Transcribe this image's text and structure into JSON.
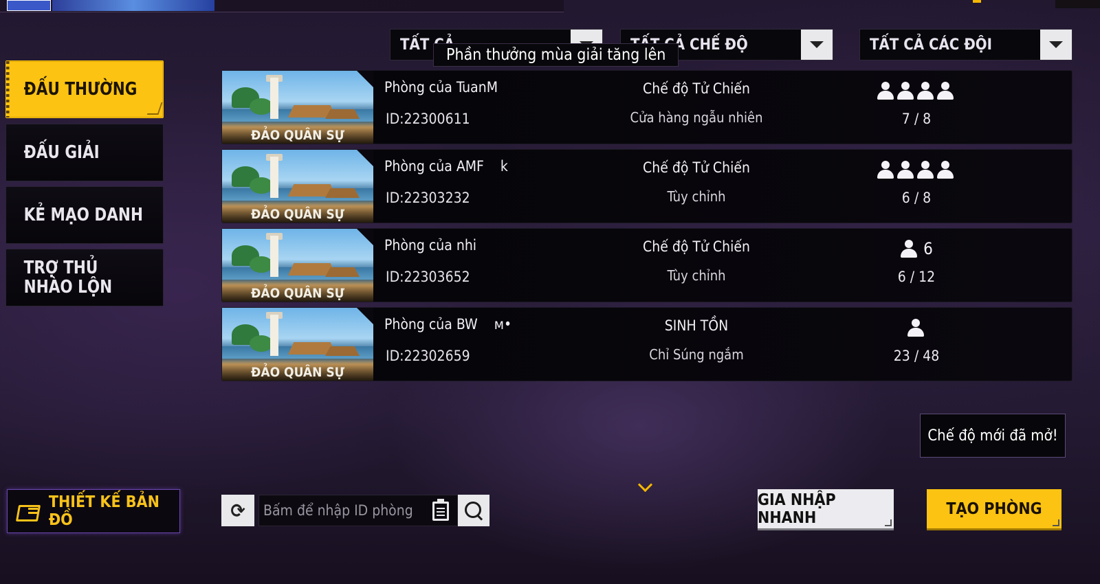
{
  "sidebar": {
    "items": [
      {
        "label": "ĐẤU THƯỜNG",
        "active": true
      },
      {
        "label": "ĐẤU GIẢI",
        "active": false
      },
      {
        "label": "KẺ MẠO DANH",
        "active": false
      },
      {
        "label": "TRỢ THỦ NHÀO LỘN",
        "active": false
      }
    ],
    "map_design_label": "THIẾT KẾ BẢN ĐỒ"
  },
  "filters": {
    "map": "TẤT CẢ",
    "mode": "TẤT CẢ CHẾ ĐỘ",
    "team": "TẤT CẢ CÁC ĐỘI",
    "tooltip": "Phần thưởng mùa giải tăng lên"
  },
  "rooms": [
    {
      "map": "ĐẢO QUÂN SỰ",
      "name": "Phòng của TuanM",
      "id": "ID:22300611",
      "mode": "Chế độ Tử Chiến",
      "sub": "Cửa hàng ngẫu nhiên",
      "team_icon_count": 4,
      "team_label": "",
      "players": "7 / 8"
    },
    {
      "map": "ĐẢO QUÂN SỰ",
      "name": "Phòng của AMF    k",
      "id": "ID:22303232",
      "mode": "Chế độ Tử Chiến",
      "sub": "Tùy chỉnh",
      "team_icon_count": 4,
      "team_label": "",
      "players": "6 / 8"
    },
    {
      "map": "ĐẢO QUÂN SỰ",
      "name": "Phòng của nhi",
      "id": "ID:22303652",
      "mode": "Chế độ Tử Chiến",
      "sub": "Tùy chỉnh",
      "team_icon_count": 1,
      "team_label": "6",
      "players": "6 / 12"
    },
    {
      "map": "ĐẢO QUÂN SỰ",
      "name": "Phòng của BW    ᴍ•",
      "id": "ID:22302659",
      "mode": "SINH TỒN",
      "sub": "Chỉ Súng ngắm",
      "team_icon_count": 1,
      "team_label": "",
      "players": "23 / 48"
    }
  ],
  "notice": "Chế độ mới đã mở!",
  "search": {
    "placeholder": "Bấm để nhập ID phòng"
  },
  "buttons": {
    "quick_join": "GIA NHẬP NHANH",
    "create_room": "TẠO PHÒNG"
  },
  "colors": {
    "accent": "#fcc313",
    "panel": "#07060a",
    "purple_glow": "#6a46b0"
  }
}
